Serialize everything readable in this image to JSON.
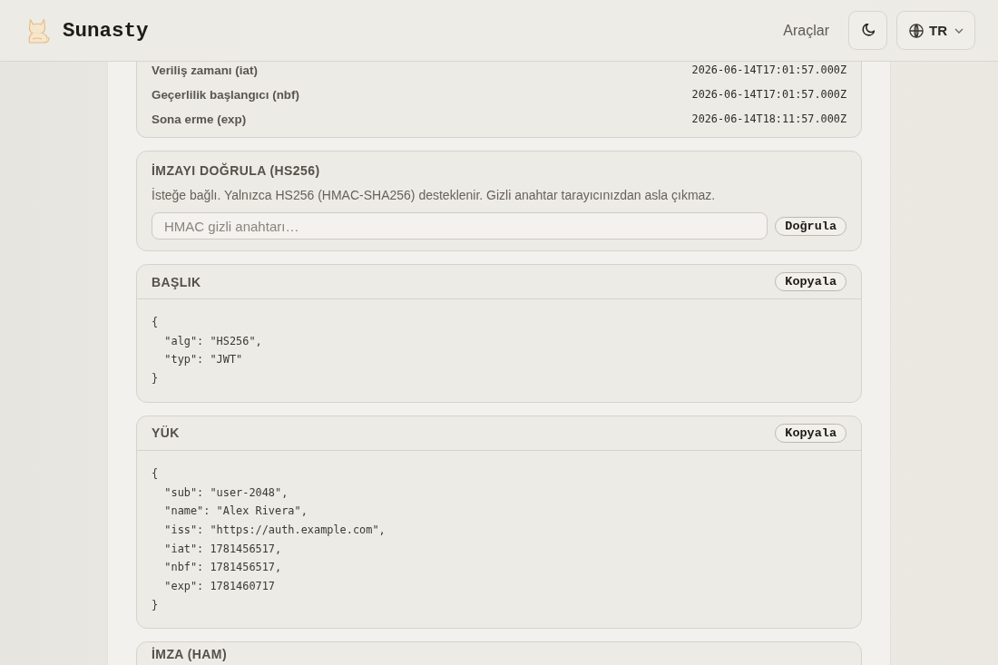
{
  "header": {
    "brand": "Sunasty",
    "nav_link": "Araçlar",
    "language": "TR"
  },
  "claims": [
    {
      "label": "Veriliş zamanı (iat)",
      "value": "2026-06-14T17:01:57.000Z"
    },
    {
      "label": "Geçerlilik başlangıcı (nbf)",
      "value": "2026-06-14T17:01:57.000Z"
    },
    {
      "label": "Sona erme (exp)",
      "value": "2026-06-14T18:11:57.000Z"
    }
  ],
  "verify": {
    "title": "İMZAYI DOĞRULA (HS256)",
    "description": "İsteğe bağlı. Yalnızca HS256 (HMAC-SHA256) desteklenir. Gizli anahtar tarayıcınızdan asla çıkmaz.",
    "secret_field": {
      "placeholder": "HMAC gizli anahtarı…"
    },
    "button": "Doğrula"
  },
  "sections": [
    {
      "title": "BAŞLIK",
      "copy_button": "Kopyala",
      "code": "{\n  \"alg\": \"HS256\",\n  \"typ\": \"JWT\"\n}"
    },
    {
      "title": "YÜK",
      "copy_button": "Kopyala",
      "code": "{\n  \"sub\": \"user-2048\",\n  \"name\": \"Alex Rivera\",\n  \"iss\": \"https://auth.example.com\",\n  \"iat\": 1781456517,\n  \"nbf\": 1781456517,\n  \"exp\": 1781460717\n}"
    },
    {
      "title": "İMZA (HAM)"
    }
  ]
}
